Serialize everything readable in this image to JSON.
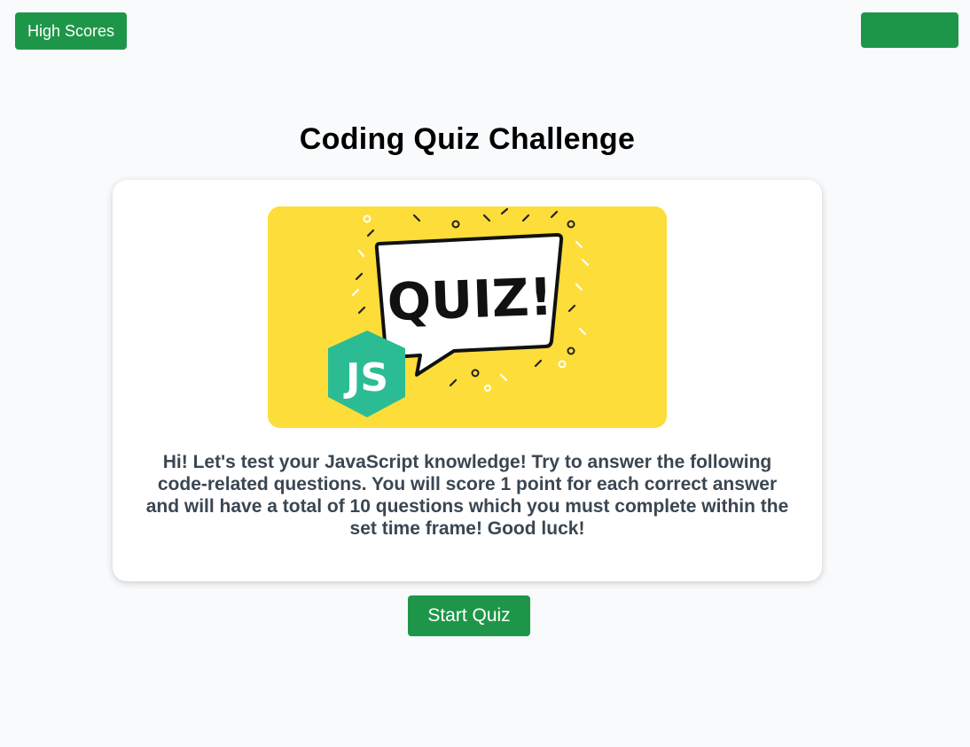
{
  "header": {
    "high_scores_label": "High Scores",
    "timer_label": ""
  },
  "main": {
    "title": "Coding Quiz Challenge",
    "image": {
      "quiz_text": "QUIZ!",
      "badge_text": "JS",
      "background_color": "#fddd3a",
      "badge_color": "#2bbc94"
    },
    "intro": "Hi! Let's test your JavaScript knowledge! Try to answer the following code-related questions. You will score 1 point for each correct answer and will have a total of 10 questions which you must complete within the set time frame! Good luck!",
    "start_label": "Start Quiz"
  },
  "colors": {
    "accent": "#1e9649",
    "page_background": "#f8fafc",
    "text_muted": "#3a4652"
  }
}
